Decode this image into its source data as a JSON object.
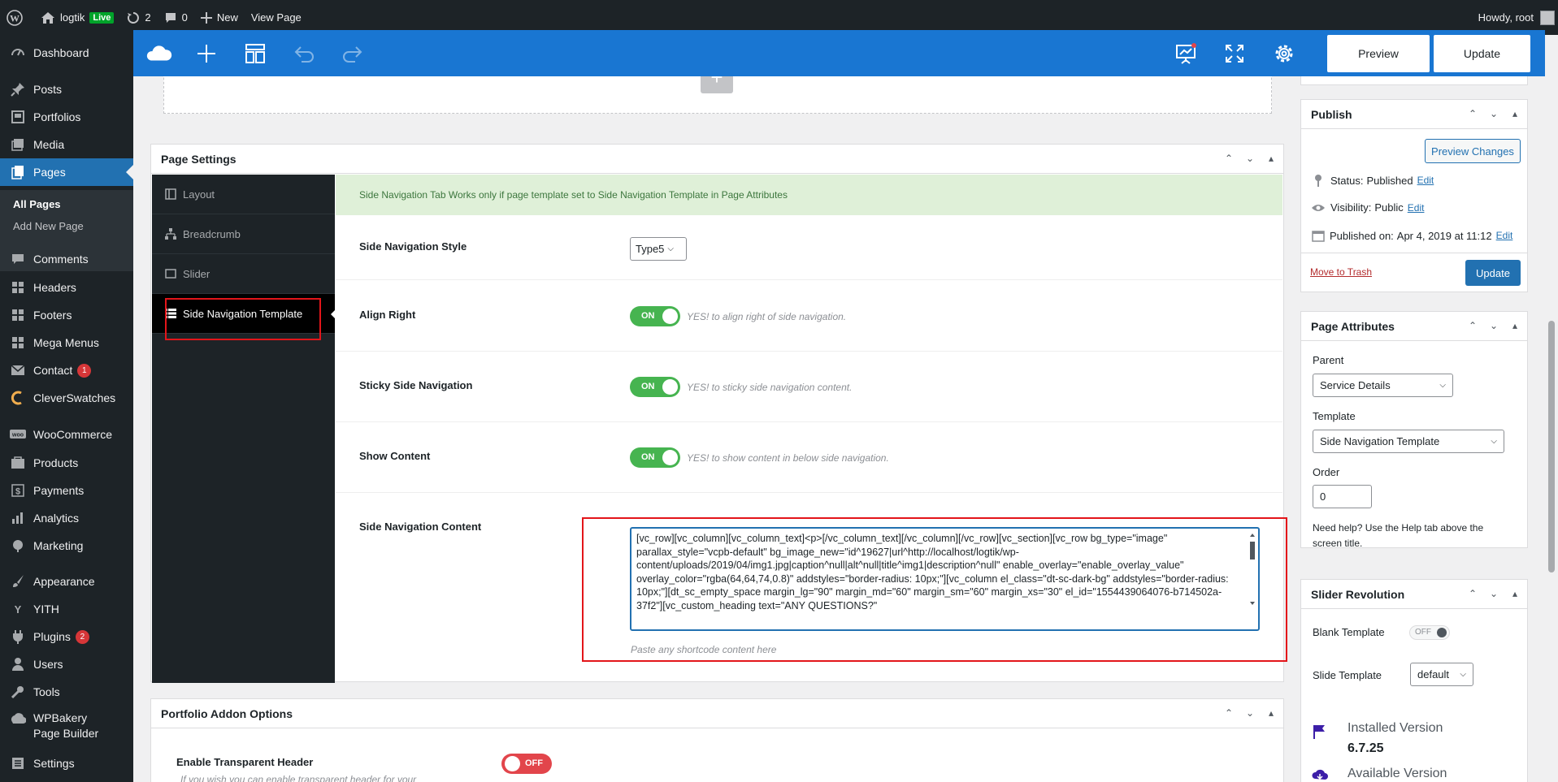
{
  "adminbar": {
    "site_name": "logtik",
    "live_label": "Live",
    "updates_count": "2",
    "comments_count": "0",
    "new_label": "New",
    "view_page_label": "View Page",
    "howdy": "Howdy, root"
  },
  "sidebar": {
    "items": [
      {
        "label": "Dashboard",
        "icon": "dashboard-icon"
      },
      {
        "label": "Posts",
        "icon": "pin-icon"
      },
      {
        "label": "Portfolios",
        "icon": "portfolio-icon"
      },
      {
        "label": "Media",
        "icon": "media-icon"
      },
      {
        "label": "Pages",
        "icon": "pages-icon"
      },
      {
        "label": "Comments",
        "icon": "comments-icon"
      },
      {
        "label": "Headers",
        "icon": "grid-icon"
      },
      {
        "label": "Footers",
        "icon": "grid-icon"
      },
      {
        "label": "Mega Menus",
        "icon": "grid-icon"
      },
      {
        "label": "Contact",
        "icon": "mail-icon",
        "badge": "1"
      },
      {
        "label": "CleverSwatches",
        "icon": "swatches-icon"
      },
      {
        "label": "WooCommerce",
        "icon": "woo-icon"
      },
      {
        "label": "Products",
        "icon": "products-icon"
      },
      {
        "label": "Payments",
        "icon": "payments-icon"
      },
      {
        "label": "Analytics",
        "icon": "analytics-icon"
      },
      {
        "label": "Marketing",
        "icon": "marketing-icon"
      },
      {
        "label": "Appearance",
        "icon": "brush-icon"
      },
      {
        "label": "YITH",
        "icon": "yith-icon"
      },
      {
        "label": "Plugins",
        "icon": "plugin-icon",
        "badge": "2"
      },
      {
        "label": "Users",
        "icon": "users-icon"
      },
      {
        "label": "Tools",
        "icon": "tools-icon"
      },
      {
        "label": "WPBakery Page Builder",
        "icon": "wpbakery-icon"
      },
      {
        "label": "Settings",
        "icon": "settings-icon"
      }
    ],
    "submenu": {
      "all_pages": "All Pages",
      "add_new": "Add New Page"
    }
  },
  "toolbar": {
    "preview_label": "Preview",
    "update_label": "Update"
  },
  "page_settings": {
    "title": "Page Settings",
    "tabs": [
      "Layout",
      "Breadcrumb",
      "Slider",
      "Side Navigation Template"
    ],
    "notice": "Side Navigation Tab Works only if page template set to Side Navigation Template in Page Attributes",
    "style_label": "Side Navigation Style",
    "style_value": "Type5",
    "align_label": "Align Right",
    "align_toggle": "ON",
    "align_desc": "YES! to align right of side navigation.",
    "sticky_label": "Sticky Side Navigation",
    "sticky_toggle": "ON",
    "sticky_desc": "YES! to sticky side navigation content.",
    "show_label": "Show Content",
    "show_toggle": "ON",
    "show_desc": "YES! to show content in below side navigation.",
    "content_label": "Side Navigation Content",
    "content_value": "[vc_row][vc_column][vc_column_text]<p>[/vc_column_text][/vc_column][/vc_row][vc_section][vc_row bg_type=\"image\" parallax_style=\"vcpb-default\" bg_image_new=\"id^19627|url^http://localhost/logtik/wp-content/uploads/2019/04/img1.jpg|caption^null|alt^null|title^img1|description^null\" enable_overlay=\"enable_overlay_value\" overlay_color=\"rgba(64,64,74,0.8)\" addstyles=\"border-radius: 10px;\"][vc_column el_class=\"dt-sc-dark-bg\" addstyles=\"border-radius: 10px;\"][dt_sc_empty_space margin_lg=\"90\" margin_md=\"60\" margin_sm=\"60\" margin_xs=\"30\" el_id=\"1554439064076-b714502a-37f2\"][vc_custom_heading text=\"ANY QUESTIONS?\"",
    "content_hint": "Paste any shortcode content here"
  },
  "portfolio_addon": {
    "title": "Portfolio Addon Options",
    "transparent_label": "Enable Transparent Header",
    "transparent_toggle": "OFF",
    "transparent_desc": "If you wish you can enable transparent header for your"
  },
  "publish": {
    "title": "Publish",
    "preview_changes": "Preview Changes",
    "status_label": "Status:",
    "status_value": "Published",
    "visibility_label": "Visibility:",
    "visibility_value": "Public",
    "published_label": "Published on:",
    "published_value": "Apr 4, 2019 at 11:12",
    "edit": "Edit",
    "trash": "Move to Trash",
    "update": "Update"
  },
  "page_attributes": {
    "title": "Page Attributes",
    "parent_label": "Parent",
    "parent_value": "Service Details",
    "template_label": "Template",
    "template_value": "Side Navigation Template",
    "order_label": "Order",
    "order_value": "0",
    "help": "Need help? Use the Help tab above the screen title."
  },
  "slider_revolution": {
    "title": "Slider Revolution",
    "blank_label": "Blank Template",
    "blank_toggle": "OFF",
    "slide_label": "Slide Template",
    "slide_value": "default",
    "installed_label": "Installed Version",
    "installed_value": "6.7.25",
    "available_label": "Available Version"
  },
  "colors": {
    "toolbar": "#1976d2",
    "admin_dark": "#1d2327",
    "wp_blue": "#2271b1",
    "toggle_on": "#46b450",
    "toggle_off": "#e2454b",
    "highlight": "#e3151a"
  }
}
